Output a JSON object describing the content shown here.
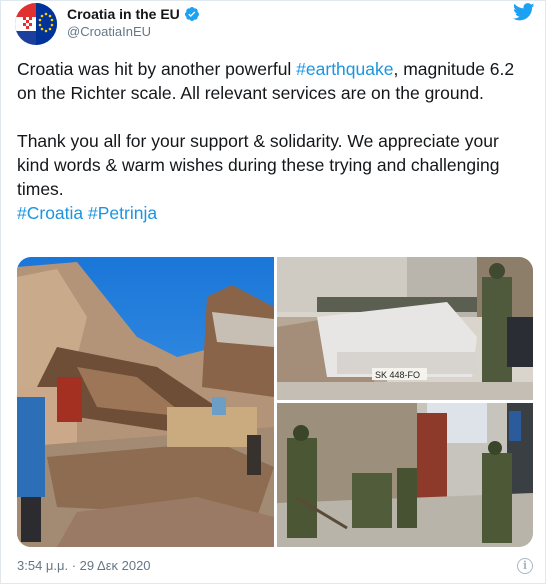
{
  "account": {
    "name": "Croatia in the EU",
    "handle": "@CroatiaInEU",
    "verified": true,
    "avatar_icon": "croatia-eu-flags-avatar"
  },
  "tweet": {
    "p1_pre": "Croatia was hit by another powerful ",
    "p1_tag": "#earthquake",
    "p1_post": ", magnitude 6.2 on the Richter scale. All relevant services are on the ground.",
    "p2": "Thank you all for your support & solidarity. We appreciate your kind words & warm wishes during these trying and challenging times.",
    "tag1": "#Croatia",
    "tag2": "#Petrinja"
  },
  "media": {
    "license_plate": "SK 448-FO"
  },
  "footer": {
    "timestamp": "3:54 μ.μ. · 29 Δεκ 2020"
  },
  "colors": {
    "hashtag": "#1b95e0",
    "twitter_blue": "#1da1f2",
    "text": "#14171a",
    "muted": "#657786"
  },
  "icons": [
    "twitter-bird-icon",
    "verified-badge-icon",
    "info-icon"
  ]
}
